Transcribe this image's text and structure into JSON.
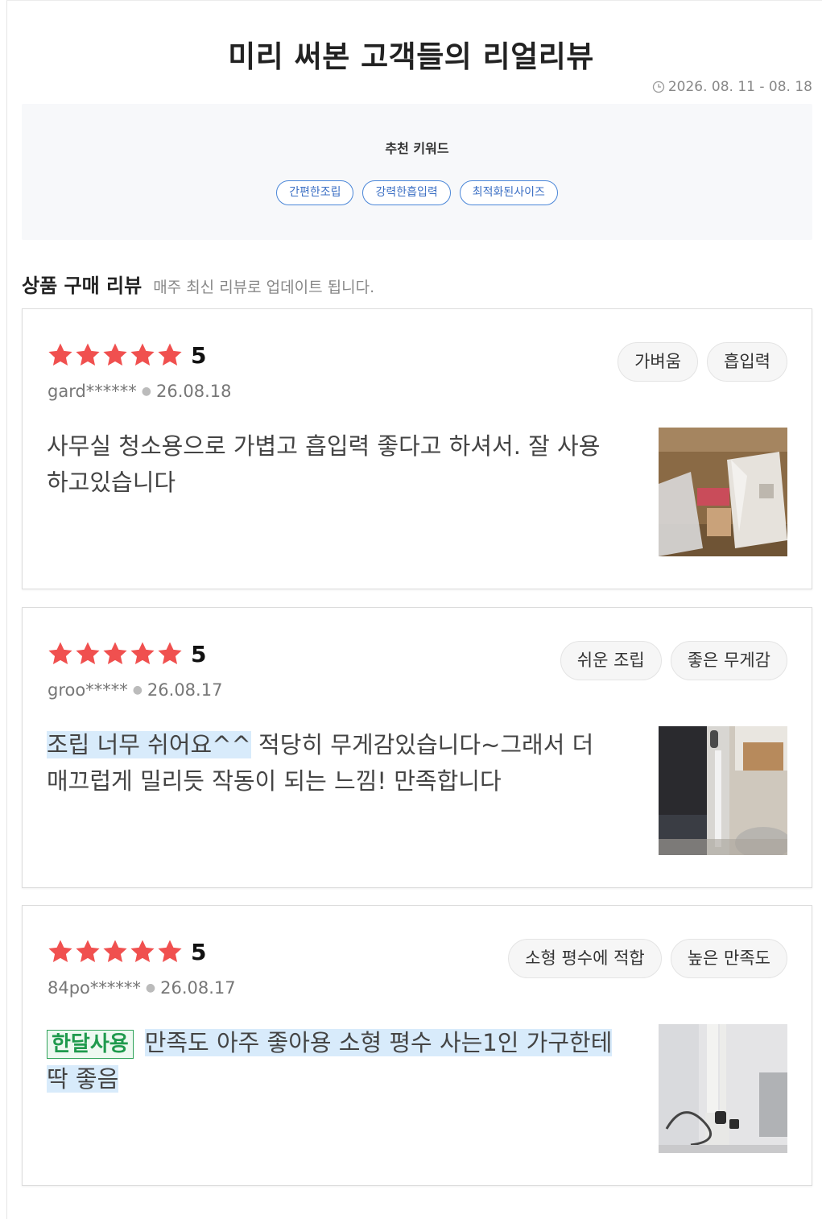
{
  "header": {
    "title": "미리 써본 고객들의 리얼리뷰",
    "period": "2026. 08. 11 - 08. 18",
    "period_icon": "clock-icon"
  },
  "keywords": {
    "title": "추천 키워드",
    "items": [
      "간편한조립",
      "강력한흡입력",
      "최적화된사이즈"
    ],
    "accent_color": "#4a86d8"
  },
  "section": {
    "title": "상품 구매 리뷰",
    "subtitle": "매주 최신 리뷰로 업데이트 됩니다."
  },
  "colors": {
    "star": "#f0504f",
    "highlight": "#d8ebfb",
    "badge": "#1f9a4d"
  },
  "reviews": [
    {
      "rating": "5",
      "stars": 5,
      "user": "gard******",
      "date": "26.08.18",
      "tags": [
        "가벼움",
        "흡입력"
      ],
      "badge": "",
      "highlight": "",
      "text": "사무실 청소용으로 가볍고 흡입력 좋다고 하셔서. 잘 사용하고있습니다"
    },
    {
      "rating": "5",
      "stars": 5,
      "user": "groo*****",
      "date": "26.08.17",
      "tags": [
        "쉬운 조립",
        "좋은 무게감"
      ],
      "badge": "",
      "highlight": "조립 너무 쉬어요^^",
      "text": " 적당히 무게감있습니다~그래서 더 매끄럽게 밀리듯 작동이 되는 느낌! 만족합니다"
    },
    {
      "rating": "5",
      "stars": 5,
      "user": "84po******",
      "date": "26.08.17",
      "tags": [
        "소형 평수에 적합",
        "높은 만족도"
      ],
      "badge": "한달사용",
      "highlight": "만족도 아주 좋아용 소형 평수 사는1인 가구한테 딱 좋음",
      "text": ""
    }
  ]
}
